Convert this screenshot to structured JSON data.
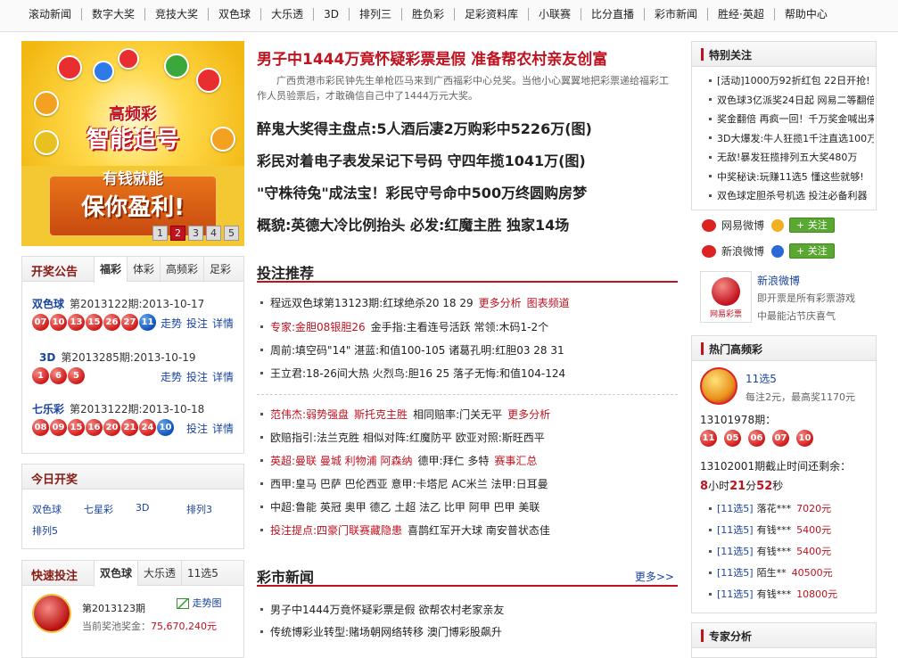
{
  "nav": [
    "滚动新闻",
    "数字大奖",
    "竞技大奖",
    "双色球",
    "大乐透",
    "3D",
    "排列三",
    "胜负彩",
    "足彩资料库",
    "小联赛",
    "比分直播",
    "彩市新闻",
    "胜经·英超",
    "帮助中心"
  ],
  "banner": {
    "title1": "高频彩",
    "title2": "智能追号",
    "title3": "有钱就能",
    "title4": "保你盈利!",
    "pages": [
      "1",
      "2",
      "3",
      "4",
      "5"
    ],
    "active_page": "2"
  },
  "kaijiang": {
    "title": "开奖公告",
    "tabs": [
      "福彩",
      "体彩",
      "高频彩",
      "足彩"
    ],
    "items": [
      {
        "name": "双色球",
        "period": "第2013122期:2013-10-17",
        "reds": [
          "07",
          "10",
          "13",
          "15",
          "26",
          "27"
        ],
        "blues": [
          "11"
        ],
        "acts": [
          "走势",
          "投注",
          "详情"
        ]
      },
      {
        "name": "3D",
        "period": "第2013285期:2013-10-19",
        "reds": [
          "1",
          "6",
          "5"
        ],
        "blues": [],
        "acts": [
          "走势",
          "投注",
          "详情"
        ]
      },
      {
        "name": "七乐彩",
        "period": "第2013122期:2013-10-18",
        "reds": [
          "08",
          "09",
          "15",
          "16",
          "20",
          "21",
          "24"
        ],
        "blues": [
          "10"
        ],
        "acts": [
          "投注",
          "详情"
        ]
      }
    ]
  },
  "today": {
    "title": "今日开奖",
    "row1": [
      "双色球",
      "七星彩",
      "3D",
      "排列3"
    ],
    "row2": [
      "排列5"
    ]
  },
  "quick": {
    "title": "快速投注",
    "tabs": [
      "双色球",
      "大乐透",
      "11选5"
    ],
    "period": "第2013123期",
    "trend": "走势图",
    "pool_label": "当前奖池奖金：",
    "pool": "75,670,240元"
  },
  "center": {
    "headline": "男子中1444万竟怀疑彩票是假 准备帮农村亲友创富",
    "summary": "广西贵港市彩民钟先生单枪匹马来到广西福彩中心兑奖。当他小心翼翼地把彩票递给福彩工作人员验票后，才敢确信自己中了1444万元大奖。",
    "big": [
      "醉鬼大奖得主盘点:5人酒后凄2万购彩中5226万(图)",
      "彩民对着电子表发呆记下号码 守四年揽1041万(图)",
      "\"守株待兔\"成法宝！彩民守号命中500万终圆购房梦",
      "概貌:英德大冷比例抬头 必发:红魔主胜 独家14场"
    ],
    "tuijian_title": "投注推荐",
    "tj1": [
      {
        "a": "程远双色球第13123期:红球绝杀20 18 29",
        "b": "更多分析",
        "c": "图表频道"
      },
      {
        "a": "专家:金胆08银胆26",
        "b": "金手指:主看连号活跃 常领:木码1-2个"
      },
      {
        "a": "周前:填空码\"14\" 湛蓝:和值100-105 诸葛孔明:红胆03 28 31"
      },
      {
        "a": "王立君:18-26间大热 火烈鸟:胆16 25 落子无悔:和值104-124"
      }
    ],
    "tj2": [
      {
        "a": "范伟杰:弱势强盘",
        "b": "斯托克主胜",
        "c": "相同赔率:门关无平",
        "d": "更多分析"
      },
      {
        "a": "欧赔指引:法兰克胜 相似对阵:红魔防平 欧亚对照:斯旺西平"
      },
      {
        "a": "英超:曼联 曼城 利物浦 阿森纳",
        "b": "德甲:拜仁 多特",
        "c": "赛事汇总"
      },
      {
        "a": "西甲:皇马 巴萨 巴伦西亚 意甲:卡塔尼 AC米兰 法甲:日耳曼"
      },
      {
        "a": "中超:鲁能 英冠 奥甲 德乙 土超 法乙 比甲 阿甲 巴甲 美联"
      },
      {
        "a": "投注提点:四豪门联赛藏隐患",
        "b": "喜鹊红军开大球 南安普状态佳"
      }
    ],
    "news_title": "彩市新闻",
    "news_more": "更多>>",
    "news": [
      "男子中1444万竟怀疑彩票是假 欲帮农村老家亲友",
      "传统博彩业转型:赌场朝网络转移 澳门博彩股飙升"
    ]
  },
  "right": {
    "tebie_title": "特别关注",
    "tebie": [
      "[活动]1000万92折红包 22日开抢!",
      "双色球3亿派奖24日起 网易二等翻倍",
      "奖金翻倍 再疯一回！千万奖金喊出来",
      "3D大爆发:牛人狂揽1千注直选100万",
      "无敌!暴发狂揽排列五大奖480万",
      "中奖秘诀:玩赚11选5 懂这些就够!",
      "双色球定胆杀号机选 投注必备利器"
    ],
    "weibo": [
      {
        "name": "网易微博",
        "btn": "+ 关注"
      },
      {
        "name": "新浪微博",
        "btn": "+ 关注"
      }
    ],
    "sina_title": "新浪微博",
    "sina_desc1": "即开票是所有彩票游戏",
    "sina_desc2": "中最能沾节庆喜气",
    "logo_text": "网易彩票",
    "hot_title": "热门高频彩",
    "hot_name": "11选5",
    "hot_desc1": "每注2元，最高奖",
    "hot_desc2": "1170元",
    "hot_period": "13101978期：",
    "hot_balls": [
      "11",
      "05",
      "06",
      "07",
      "10"
    ],
    "deadline_label": "13102001期截止时间还剩余：",
    "deadline_h": "8",
    "deadline_m": "21",
    "deadline_s": "52",
    "units": [
      "小时",
      "分",
      "秒"
    ],
    "winners": [
      {
        "g": "[11选5]",
        "n": "落花***",
        "m": "7020元"
      },
      {
        "g": "[11选5]",
        "n": "有钱***",
        "m": "5400元"
      },
      {
        "g": "[11选5]",
        "n": "有钱***",
        "m": "5400元"
      },
      {
        "g": "[11选5]",
        "n": "陌生**",
        "m": "40500元"
      },
      {
        "g": "[11选5]",
        "n": "有钱***",
        "m": "10800元"
      }
    ],
    "zhuanjia_title": "专家分析"
  }
}
